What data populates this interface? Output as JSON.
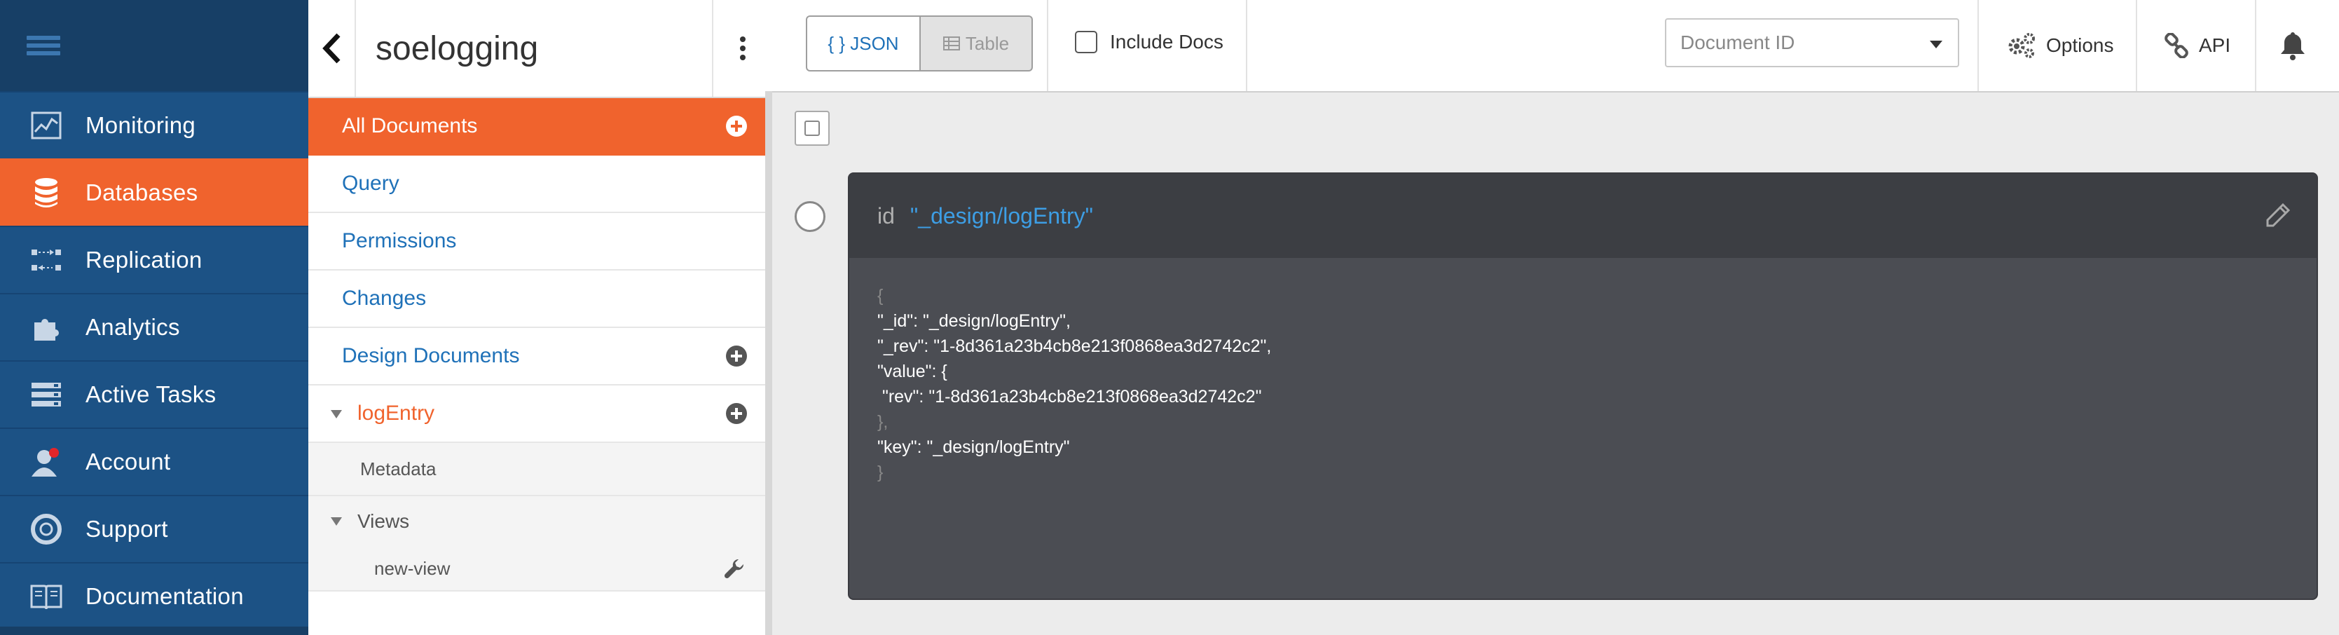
{
  "nav": {
    "items": [
      {
        "label": "Monitoring",
        "icon": "monitoring-chart-icon"
      },
      {
        "label": "Databases",
        "icon": "database-icon",
        "active": true
      },
      {
        "label": "Replication",
        "icon": "replication-icon"
      },
      {
        "label": "Analytics",
        "icon": "puzzle-icon"
      },
      {
        "label": "Active Tasks",
        "icon": "tasks-icon"
      },
      {
        "label": "Account",
        "icon": "account-icon"
      },
      {
        "label": "Support",
        "icon": "lifebuoy-icon"
      },
      {
        "label": "Documentation",
        "icon": "book-icon"
      }
    ]
  },
  "sidebar": {
    "db_name": "soelogging",
    "all_documents": "All Documents",
    "query": "Query",
    "permissions": "Permissions",
    "changes": "Changes",
    "design_documents": "Design Documents",
    "design_doc": "logEntry",
    "metadata": "Metadata",
    "views": "Views",
    "view_name": "new-view"
  },
  "toolbar": {
    "json_label": "{ } JSON",
    "table_label": "Table",
    "include_docs": "Include Docs",
    "doc_id_placeholder": "Document ID",
    "options_label": "Options",
    "api_label": "API"
  },
  "document": {
    "id_key": "id",
    "id_value": "\"_design/logEntry\"",
    "lines": [
      {
        "text": "{",
        "punct": true
      },
      {
        "text": "\"_id\": \"_design/logEntry\","
      },
      {
        "text": "\"_rev\": \"1-8d361a23b4cb8e213f0868ea3d2742c2\","
      },
      {
        "text": "\"value\": {"
      },
      {
        "text": " \"rev\": \"1-8d361a23b4cb8e213f0868ea3d2742c2\""
      },
      {
        "text": "},",
        "punct": true
      },
      {
        "text": "\"key\": \"_design/logEntry\""
      },
      {
        "text": "}",
        "punct": true
      }
    ]
  },
  "colors": {
    "accent": "#f0632d",
    "nav_bg": "#1c5285",
    "link": "#1f71b8",
    "card_bg": "#4b4d53"
  }
}
